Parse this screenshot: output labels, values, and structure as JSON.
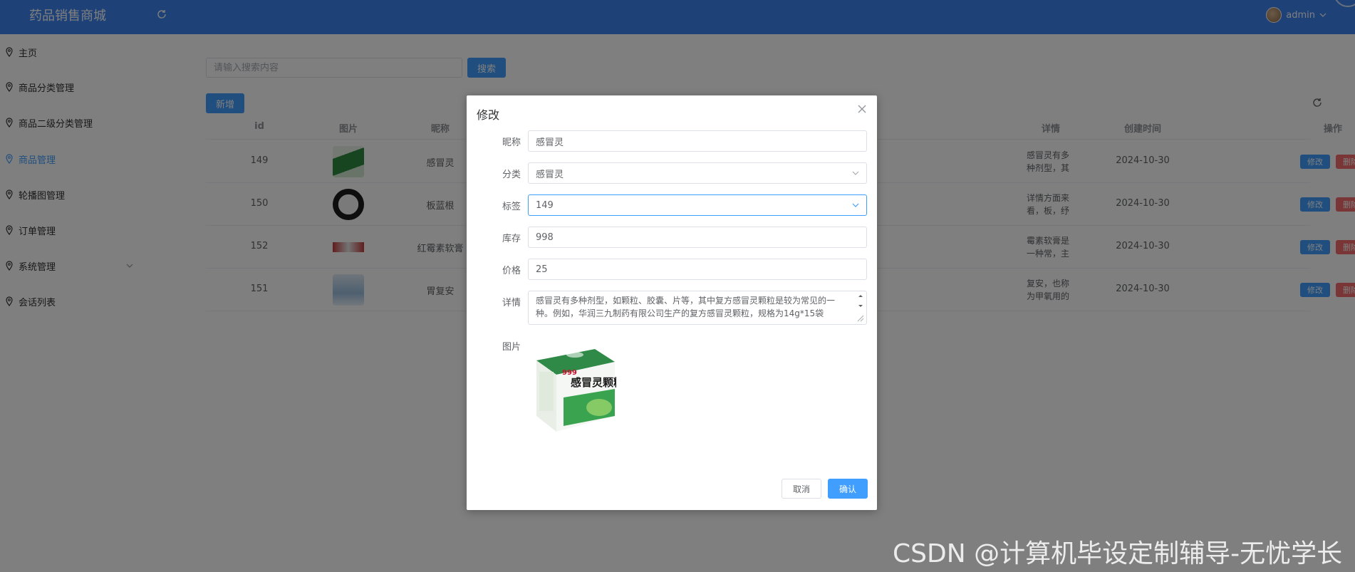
{
  "app": {
    "title": "药品销售商城",
    "user": "admin"
  },
  "sidebar": {
    "items": [
      {
        "label": "主页"
      },
      {
        "label": "商品分类管理"
      },
      {
        "label": "商品二级分类管理"
      },
      {
        "label": "商品管理",
        "active": true
      },
      {
        "label": "轮播图管理"
      },
      {
        "label": "订单管理"
      },
      {
        "label": "系统管理",
        "expandable": true
      },
      {
        "label": "会话列表"
      }
    ]
  },
  "toolbar": {
    "search_placeholder": "请输入搜索内容",
    "search_label": "搜索",
    "add_label": "新增"
  },
  "table": {
    "headers": [
      "id",
      "图片",
      "昵称",
      "详情",
      "创建时间",
      "操作"
    ],
    "rows": [
      {
        "id": "149",
        "name": "感冒灵",
        "detail": "感冒灵有多种剂型，其中复方感冒灵",
        "created": "2024-10-30",
        "edit": "修改",
        "delete": "删除"
      },
      {
        "id": "150",
        "name": "板蓝根",
        "detail": "详情方面来看，板，纾讨除涡沙，晤",
        "created": "2024-10-30",
        "edit": "修改",
        "delete": "删除"
      },
      {
        "id": "152",
        "name": "红霉素软膏",
        "detail": "霉素软膏是一种常，主要用于治疗各",
        "created": "2024-10-30",
        "edit": "修改",
        "delete": "删除"
      },
      {
        "id": "151",
        "name": "胃复安",
        "detail": "复安，也称为甲氧用的西药。它的主",
        "created": "2024-10-30",
        "edit": "修改",
        "delete": "删除"
      }
    ]
  },
  "dialog": {
    "title": "修改",
    "fields": {
      "name": {
        "label": "昵称",
        "value": "感冒灵"
      },
      "category": {
        "label": "分类",
        "value": "感冒灵"
      },
      "tag": {
        "label": "标签",
        "value": "149"
      },
      "stock": {
        "label": "库存",
        "value": "998"
      },
      "price": {
        "label": "价格",
        "value": "25"
      },
      "detail": {
        "label": "详情",
        "value": "感冒灵有多种剂型，如颗粒、胶囊、片等，其中复方感冒灵颗粒是较为常见的一种。例如，华润三九制药有限公司生产的复方感冒灵颗粒，规格为14g*15袋"
      },
      "image": {
        "label": "图片"
      }
    },
    "product_image_text": "感冒灵颗粒",
    "product_brand": "999",
    "cancel_label": "取消",
    "confirm_label": "确认"
  },
  "watermark": "CSDN @计算机毕设定制辅导-无忧学长",
  "colors": {
    "header": "#3d85f0",
    "primary": "#409eff",
    "danger": "#f56c6c"
  }
}
